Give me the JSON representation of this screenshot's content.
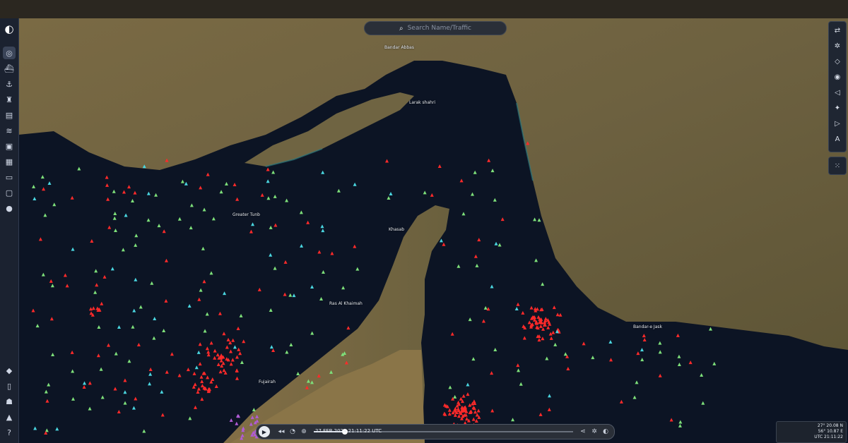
{
  "app": {
    "search_placeholder": "Search Name/Traffic",
    "icons": {
      "logo": "half-circle-logo-icon",
      "search": "search-icon"
    }
  },
  "left_sidebar": {
    "items": [
      {
        "name": "globe-icon"
      },
      {
        "name": "ship-icon"
      },
      {
        "name": "anchor-icon"
      },
      {
        "name": "tower-icon"
      },
      {
        "name": "layers-icon"
      },
      {
        "name": "wind-icon"
      },
      {
        "name": "camera-icon"
      },
      {
        "name": "calendar-icon"
      },
      {
        "name": "folder-icon"
      },
      {
        "name": "message-icon"
      },
      {
        "name": "pin-icon"
      }
    ],
    "bottom_items": [
      {
        "name": "tag-icon"
      },
      {
        "name": "document-icon"
      },
      {
        "name": "users-icon"
      },
      {
        "name": "bell-icon"
      },
      {
        "name": "help-icon"
      }
    ]
  },
  "right_toolbar": {
    "items": [
      {
        "name": "swap-icon"
      },
      {
        "name": "settings-icon"
      },
      {
        "name": "shield-icon"
      },
      {
        "name": "database-icon"
      },
      {
        "name": "volume-icon"
      },
      {
        "name": "sparkle-icon"
      },
      {
        "name": "play-icon"
      },
      {
        "name": "text-icon"
      }
    ],
    "extra": {
      "name": "grid-icon"
    }
  },
  "map": {
    "place_labels": [
      {
        "text": "Bandar Abbas"
      },
      {
        "text": "Larak shahri"
      },
      {
        "text": "Greater Tunb"
      },
      {
        "text": "Khasab"
      },
      {
        "text": "Ras Al Khaimah"
      },
      {
        "text": "Bandar-e Jask"
      },
      {
        "text": "Fujairah"
      }
    ],
    "colors": {
      "water": "#0c1424",
      "land": "#6b5f3c",
      "tanker": "#ff2a2a",
      "cargo": "#7ee07a",
      "passenger": "#4ad6e0",
      "other": "#b05bd6"
    }
  },
  "playback": {
    "timestamp": "27 FEB 2024 21:11:22 UTC",
    "progress": 0.12,
    "icons": [
      "play-icon",
      "rewind-icon",
      "speed-icon",
      "target-icon",
      "share-icon",
      "settings-icon",
      "toggle-icon"
    ]
  },
  "coordinates": {
    "lat": "27° 20.08 N",
    "lon": "56° 10.87 E",
    "extra": "UTC 21:11:22"
  }
}
